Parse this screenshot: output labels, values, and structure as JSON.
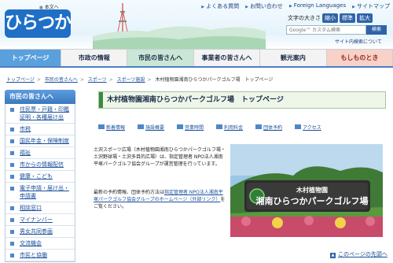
{
  "header": {
    "logo_text": "ひらつか",
    "skip_link": "本文へ",
    "top_links": [
      "よくある質問",
      "お問い合わせ",
      "Foreign Languages",
      "サイトマップ"
    ],
    "font_size_label": "文字の大きさ",
    "font_size_options": [
      "縮小",
      "標準",
      "拡大"
    ],
    "search_placeholder": "Google™ カスタム検索",
    "search_button": "検索",
    "site_description_link": "サイト内検索について"
  },
  "nav": {
    "items": [
      "トップページ",
      "市政の情報",
      "市民の皆さんへ",
      "事業者の皆さんへ",
      "観光案内",
      "もしものとき"
    ]
  },
  "breadcrumb": {
    "items": [
      "トップページ",
      "市民の皆さんへ",
      "スポーツ",
      "スポーツ施設"
    ],
    "current": "木村植物園湘南ひらつかパークゴルフ場　トップページ"
  },
  "sidebar": {
    "title": "市民の皆さんへ",
    "items": [
      "住民票・戸籍・印鑑証明・各種届け出",
      "市税",
      "国民年金・保険制度",
      "福祉",
      "市からの情報配信",
      "健康・こども",
      "電子申請・届け出・申請書",
      "相談窓口",
      "マイナンバー",
      "男女共同参画",
      "交流機会",
      "市民と協働"
    ]
  },
  "main": {
    "title": "木村植物園湘南ひらつかパークゴルフ場　トップページ",
    "anchors": [
      "新着情報",
      "施設概要",
      "営業時間",
      "利用料金",
      "団体予約",
      "アクセス"
    ],
    "paragraph1": "土沢スポーツ広場（木村植物園湘南ひらつかパークゴルフ場・土沢野球場・土沢多目的広場）は、指定管理者 NPO法人湘南平塚パークゴルフ協会グループが運営管理を行っています。",
    "paragraph2_prefix": "最新の予約情報、団体予約方法は",
    "paragraph2_link": "指定管理者 NPO法人湘南平塚パークゴルフ協会グループのホームページ（外部リンク）",
    "paragraph2_suffix": "をご覧ください。",
    "sign_line1": "木村植物園",
    "sign_line2": "湘南ひらつかパークゴルフ場",
    "back_to_top": "このページの先頭へ"
  },
  "colors": {
    "accent": "#2f63a8",
    "nav_home": "#5aa0dd",
    "nav_active": "#c9e6d6",
    "nav_emergency": "#f6d2c9",
    "title_bar": "#3b8a3e"
  }
}
